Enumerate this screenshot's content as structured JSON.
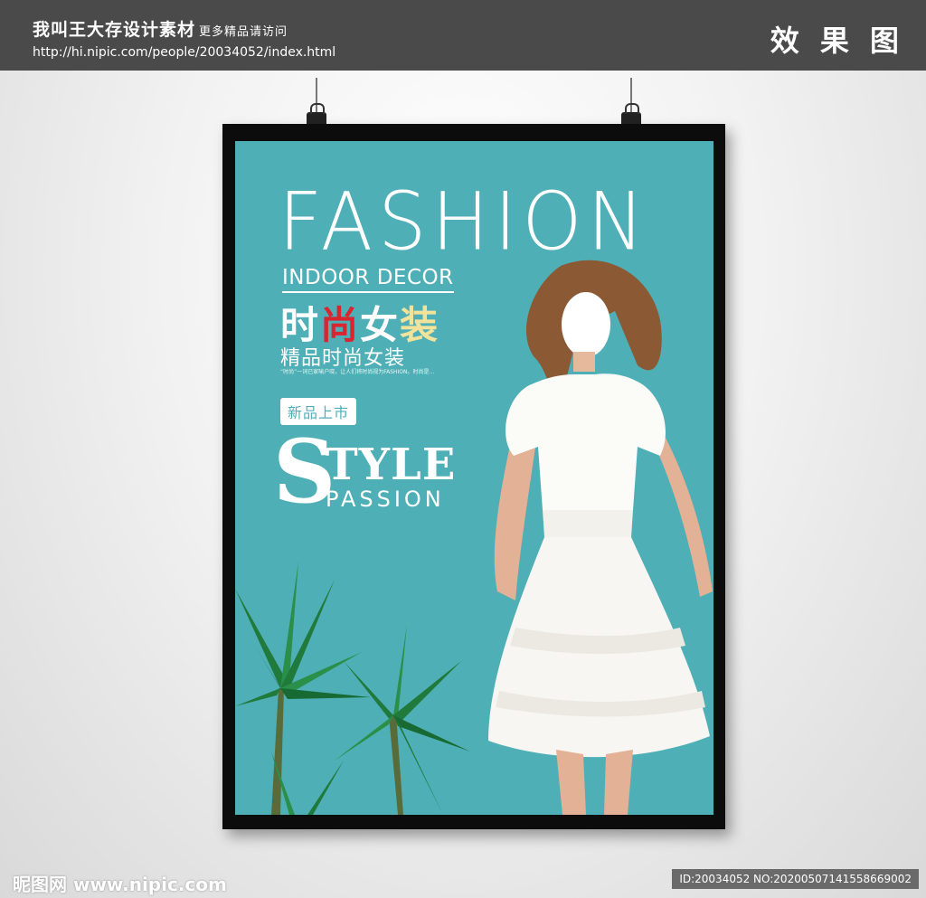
{
  "header": {
    "site_name": "我叫王大存设计素材",
    "site_note": "更多精品请访问",
    "url": "http://hi.nipic.com/people/20034052/index.html",
    "effect_label": "效 果 图"
  },
  "poster": {
    "title": "FASHION",
    "subtitle": "INDOOR DECOR",
    "cn_title_1": "时",
    "cn_title_2": "尚",
    "cn_title_3": "女",
    "cn_title_4": "装",
    "cn_subtitle": "精品时尚女装",
    "description": "“时尚”一词已家喻户晓，让人们将时尚视为FASHION。时尚是...",
    "badge": "新品上市",
    "style_initial": "S",
    "style_rest": "TYLE",
    "style_passion": "PASSION",
    "colors": {
      "background": "#4fafb6",
      "accent_red": "#d8252f",
      "accent_yellow": "#f1e39c"
    }
  },
  "watermark": {
    "left": "昵图网 www.nipic.com",
    "right": "ID:20034052 NO:20200507141558669002"
  }
}
